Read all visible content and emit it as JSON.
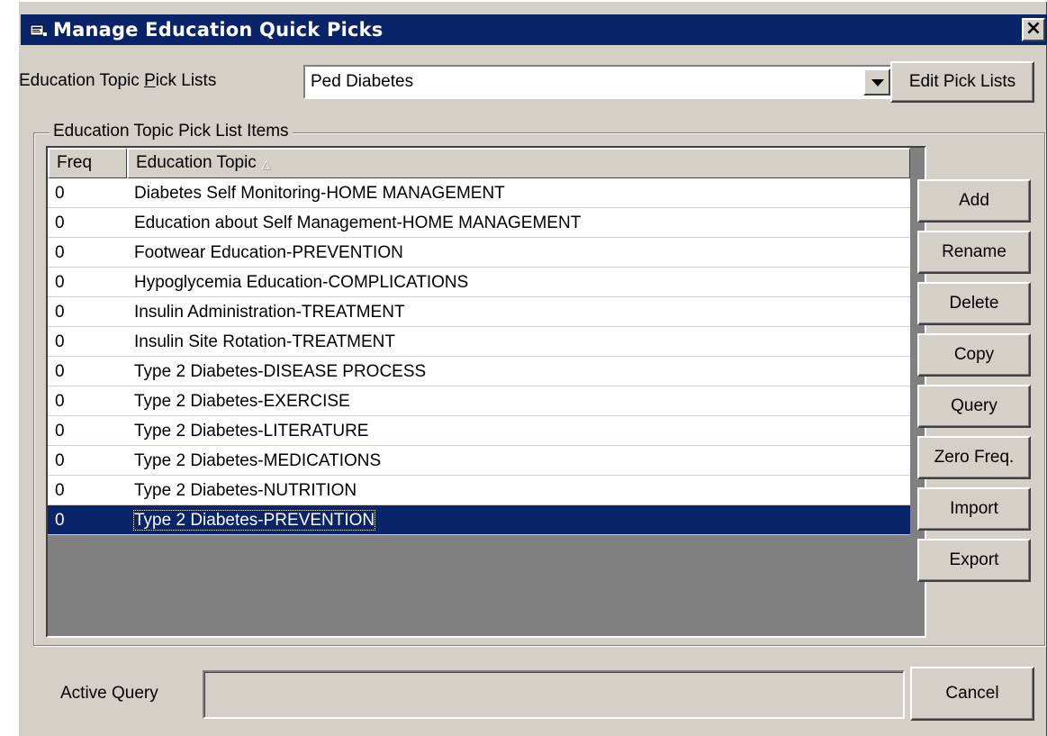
{
  "window": {
    "title": "Manage Education Quick Picks",
    "close_label": "×"
  },
  "picklist": {
    "label_before": "Education Topic ",
    "label_mnemonic": "P",
    "label_after": "ick Lists",
    "selected_value": "Ped Diabetes",
    "edit_button": "Edit Pick Lists"
  },
  "items_group": {
    "label": "Education Topic Pick List Items",
    "columns": [
      "Freq",
      "Education Topic"
    ],
    "rows": [
      {
        "freq": "0",
        "topic": "Diabetes Self Monitoring-HOME MANAGEMENT",
        "selected": false
      },
      {
        "freq": "0",
        "topic": "Education about Self Management-HOME MANAGEMENT",
        "selected": false
      },
      {
        "freq": "0",
        "topic": "Footwear Education-PREVENTION",
        "selected": false
      },
      {
        "freq": "0",
        "topic": "Hypoglycemia Education-COMPLICATIONS",
        "selected": false
      },
      {
        "freq": "0",
        "topic": "Insulin Administration-TREATMENT",
        "selected": false
      },
      {
        "freq": "0",
        "topic": "Insulin Site Rotation-TREATMENT",
        "selected": false
      },
      {
        "freq": "0",
        "topic": "Type 2 Diabetes-DISEASE PROCESS",
        "selected": false
      },
      {
        "freq": "0",
        "topic": "Type 2 Diabetes-EXERCISE",
        "selected": false
      },
      {
        "freq": "0",
        "topic": "Type 2 Diabetes-LITERATURE",
        "selected": false
      },
      {
        "freq": "0",
        "topic": "Type 2 Diabetes-MEDICATIONS",
        "selected": false
      },
      {
        "freq": "0",
        "topic": "Type 2 Diabetes-NUTRITION",
        "selected": false
      },
      {
        "freq": "0",
        "topic": "Type 2 Diabetes-PREVENTION",
        "selected": true
      }
    ]
  },
  "actions": {
    "add": "Add",
    "rename": "Rename",
    "delete": "Delete",
    "copy": "Copy",
    "query": "Query",
    "zero_freq": "Zero Freq.",
    "import": "Import",
    "export": "Export"
  },
  "footer": {
    "active_query_label": "Active Query",
    "active_query_value": "",
    "cancel": "Cancel"
  },
  "colors": {
    "titlebar": "#0a246a",
    "selection": "#0a246a",
    "face": "#d4d0c8"
  }
}
